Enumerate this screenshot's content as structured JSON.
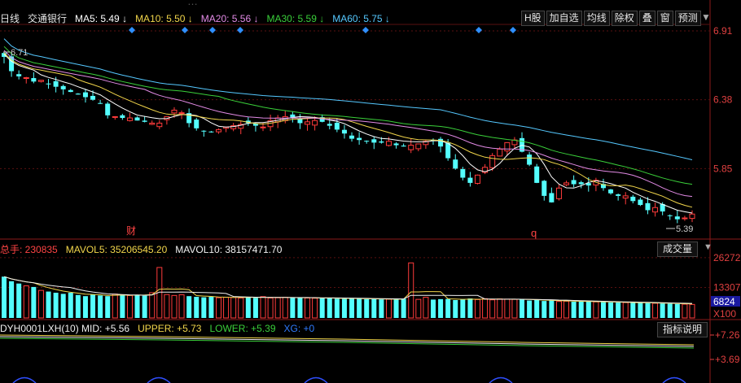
{
  "header": {
    "overlay_title": "…",
    "partial_prefix": "日线",
    "stock_name": "交通银行",
    "ma": [
      {
        "label": "MA5: 5.49",
        "color": "#ffffff"
      },
      {
        "label": "MA10: 5.50",
        "color": "#f2d64b"
      },
      {
        "label": "MA20: 5.56",
        "color": "#e38be6"
      },
      {
        "label": "MA30: 5.59",
        "color": "#3ad03a"
      },
      {
        "label": "MA60: 5.75",
        "color": "#55c8ff"
      }
    ]
  },
  "toolbar": {
    "buttons": [
      "H股",
      "加自选",
      "均线",
      "除权",
      "叠",
      "窗",
      "预测"
    ],
    "menu_arrow": "▼"
  },
  "price_axis": {
    "ticks": [
      "6.91",
      "6.38",
      "5.85"
    ]
  },
  "annotations": {
    "high_label": "6.71",
    "low_label": "5.39",
    "event_1": "财",
    "event_2": "q"
  },
  "volume_panel": {
    "title_prefix": "总手: 230835",
    "mavol5": "MAVOL5: 35206545.20",
    "mavol10": "MAVOL10: 38157471.70",
    "button": "成交量",
    "axis_ticks": [
      "26272",
      "13307",
      "6824"
    ],
    "unit": "X100"
  },
  "indicator_panel": {
    "name": "DYH0001LXH(10) MID: +5.56",
    "upper": "UPPER: +5.73",
    "lower": "LOWER: +5.39",
    "xg": "XG: +0",
    "button": "指标说明",
    "axis_ticks": [
      "+7.26",
      "+3.69"
    ]
  },
  "chart_data": {
    "type": "candlestick",
    "y_range": [
      5.32,
      6.96
    ],
    "closes": [
      6.71,
      6.6,
      6.56,
      6.55,
      6.52,
      6.53,
      6.5,
      6.48,
      6.46,
      6.44,
      6.42,
      6.4,
      6.38,
      6.35,
      6.26,
      6.25,
      6.24,
      6.24,
      6.22,
      6.21,
      6.2,
      6.2,
      6.25,
      6.3,
      6.28,
      6.2,
      6.16,
      6.14,
      6.13,
      6.15,
      6.17,
      6.18,
      6.19,
      6.2,
      6.18,
      6.17,
      6.22,
      6.24,
      6.25,
      6.24,
      6.2,
      6.21,
      6.22,
      6.21,
      6.18,
      6.15,
      6.12,
      6.08,
      6.07,
      6.06,
      6.05,
      6.05,
      6.06,
      6.03,
      6.02,
      6.03,
      6.04,
      6.06,
      6.07,
      6.02,
      5.93,
      5.85,
      5.78,
      5.74,
      5.8,
      5.86,
      5.95,
      6.0,
      6.05,
      6.07,
      5.98,
      5.88,
      5.74,
      5.64,
      5.59,
      5.7,
      5.74,
      5.73,
      5.73,
      5.72,
      5.76,
      5.7,
      5.66,
      5.64,
      5.64,
      5.6,
      5.57,
      5.53,
      5.55,
      5.52,
      5.49,
      5.46,
      5.47,
      5.5
    ],
    "volumes": [
      18000,
      16000,
      15000,
      14000,
      13500,
      12000,
      11500,
      11000,
      10500,
      11000,
      10000,
      9500,
      10200,
      9800,
      9500,
      10400,
      10000,
      9800,
      10100,
      9700,
      11000,
      22000,
      10200,
      9800,
      10100,
      9500,
      9200,
      9000,
      9200,
      8800,
      9000,
      8900,
      8700,
      9200,
      8800,
      9300,
      8700,
      8800,
      9000,
      8700,
      8900,
      8700,
      8600,
      8500,
      8800,
      8400,
      8300,
      8500,
      8400,
      8200,
      8300,
      8100,
      8200,
      8000,
      8400,
      24000,
      8100,
      9000,
      8000,
      8200,
      8300,
      7800,
      8200,
      8500,
      8000,
      8400,
      7900,
      8300,
      8200,
      8100,
      8000,
      7600,
      7800,
      7400,
      7600,
      7200,
      7300,
      7100,
      7200,
      7100,
      7000,
      6900,
      6800,
      6700,
      6700,
      6600,
      6600,
      6500,
      6400,
      6300,
      6200,
      6100,
      6000,
      5900
    ],
    "volume_range": [
      0,
      28000
    ]
  }
}
